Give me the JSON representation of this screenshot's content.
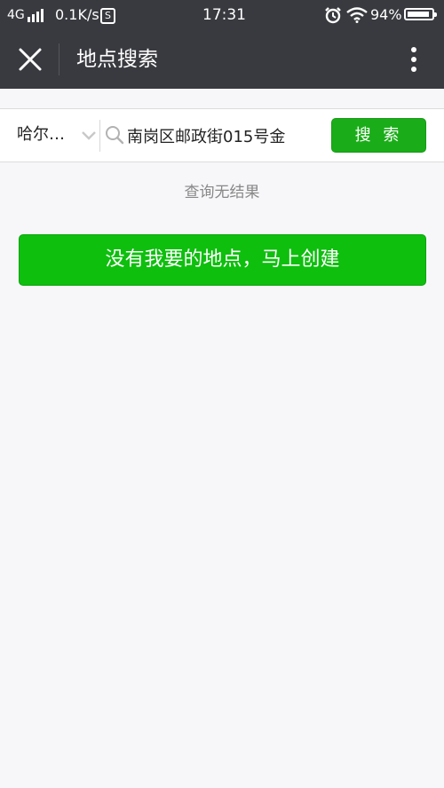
{
  "status_bar": {
    "network": "4G",
    "speed": "0.1K/s",
    "s_badge": "S",
    "time": "17:31",
    "battery": "94%",
    "battery_level": 0.94,
    "icons": [
      "signal-icon",
      "s-icon",
      "alarm-icon",
      "wifi-icon",
      "battery-icon"
    ]
  },
  "header": {
    "title": "地点搜索",
    "close_icon": "close-icon",
    "more_icon": "more-vertical-icon"
  },
  "search": {
    "city": "哈尔…",
    "query": "南岗区邮政街015号金",
    "button_label": "搜 索"
  },
  "results": {
    "empty_message": "查询无结果",
    "create_button_label": "没有我要的地点，马上创建"
  },
  "colors": {
    "header_bg": "#393a3f",
    "page_bg": "#f7f7fa",
    "primary_green": "#1aad19",
    "create_green": "#0ebf0e",
    "muted_text": "#888888"
  }
}
